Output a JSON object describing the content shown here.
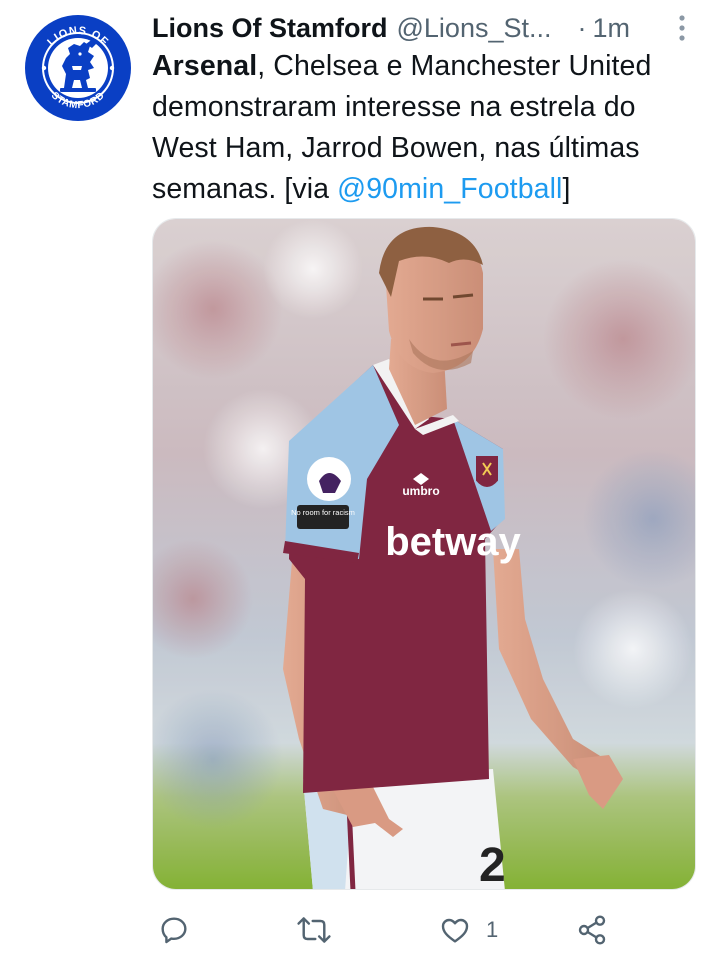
{
  "author": {
    "display_name": "Lions Of Stamford",
    "handle": "@Lions_St...",
    "separator": "·",
    "time": "1m",
    "avatar": {
      "ring_text_top": "LIONS OF",
      "ring_text_bottom": "STAMFORD",
      "color": "#0a3fc4"
    }
  },
  "tweet": {
    "lead": "Arsenal",
    "text_part1": ", Chelsea e Manchester United demonstraram interesse na estrela do West Ham, Jarrod Bowen, nas últimas semanas. [via ",
    "mention": "@90min_Football",
    "text_part2": "]"
  },
  "media": {
    "description_icon": "photo-of-footballer",
    "shirt_sponsor": "betway",
    "shirt_brand": "umbro",
    "sleeve_badge": "No room for racism",
    "shirt_number": "2"
  },
  "actions": {
    "reply_icon": "reply-icon",
    "retweet_icon": "retweet-icon",
    "like_icon": "like-icon",
    "like_count": "1",
    "share_icon": "share-icon"
  },
  "colors": {
    "link": "#1d9bf0",
    "secondary_text": "#536471",
    "primary_text": "#0f1419",
    "claret": "#7b1e3a",
    "sky_blue": "#9cc3e3"
  }
}
